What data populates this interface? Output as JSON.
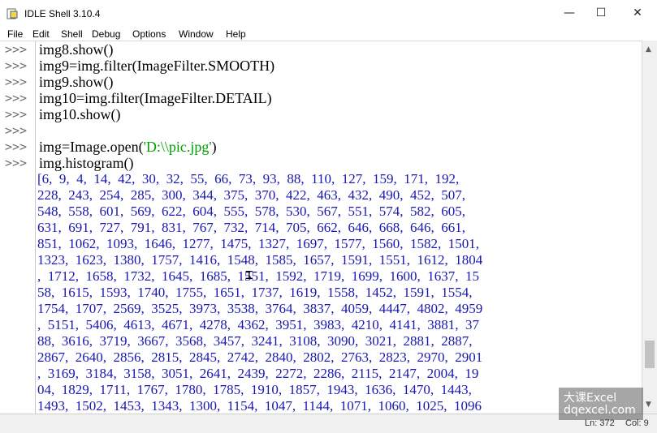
{
  "window": {
    "title": "IDLE Shell 3.10.4"
  },
  "menu": [
    "File",
    "Edit",
    "Shell",
    "Debug",
    "Options",
    "Window",
    "Help"
  ],
  "prompt": ">>>",
  "code_lines": [
    "img8.show()",
    "img9=img.filter(ImageFilter.SMOOTH)",
    "img9.show()",
    "img10=img.filter(ImageFilter.DETAIL)",
    "img10.show()",
    "",
    "img=Image.open(",
    "img.histogram()"
  ],
  "open_string": "'D:\\\\pic.jpg'",
  "open_close": ")",
  "output_lines": [
    "[6,  9,  4,  14,  42,  30,  32,  55,  66,  73,  93,  88,  110,  127,  159,  171,  192,",
    "228,  243,  254,  285,  300,  344,  375,  370,  422,  463,  432,  490,  452,  507,",
    "548,  558,  601,  569,  622,  604,  555,  578,  530,  567,  551,  574,  582,  605,",
    "631,  691,  727,  791,  831,  767,  732,  714,  705,  662,  646,  668,  646,  661,",
    "851,  1062,  1093,  1646,  1277,  1475,  1327,  1697,  1577,  1560,  1582,  1501,",
    "1323,  1623,  1380,  1757,  1416,  1548,  1585,  1657,  1591,  1551,  1612,  1804",
    ",  1712,  1658,  1732,  1645,  1685,  1551,  1592,  1719,  1699,  1600,  1637,  15",
    "58,  1615,  1593,  1740,  1755,  1651,  1737,  1619,  1558,  1452,  1591,  1554,",
    "1754,  1707,  2569,  3525,  3973,  3538,  3764,  3837,  4059,  4447,  4802,  4959",
    ",  5151,  5406,  4613,  4671,  4278,  4362,  3951,  3983,  4210,  4141,  3881,  37",
    "88,  3616,  3719,  3667,  3568,  3457,  3241,  3108,  3090,  3021,  2881,  2887,",
    "2867,  2640,  2856,  2815,  2845,  2742,  2840,  2802,  2763,  2823,  2970,  2901",
    ",  3169,  3184,  3158,  3051,  2641,  2439,  2272,  2286,  2115,  2147,  2004,  19",
    "04,  1829,  1711,  1767,  1780,  1785,  1910,  1857,  1943,  1636,  1470,  1443,",
    "1493,  1502,  1453,  1343,  1300,  1154,  1047,  1144,  1071,  1060,  1025,  1096"
  ],
  "status": {
    "line": "Ln: 372",
    "col": "Col: 9"
  },
  "watermark": {
    "line1": "大课Excel",
    "line2": "dqexcel.com"
  },
  "colors": {
    "output": "#1818b0",
    "string": "#00a000",
    "prompt": "#707070"
  }
}
